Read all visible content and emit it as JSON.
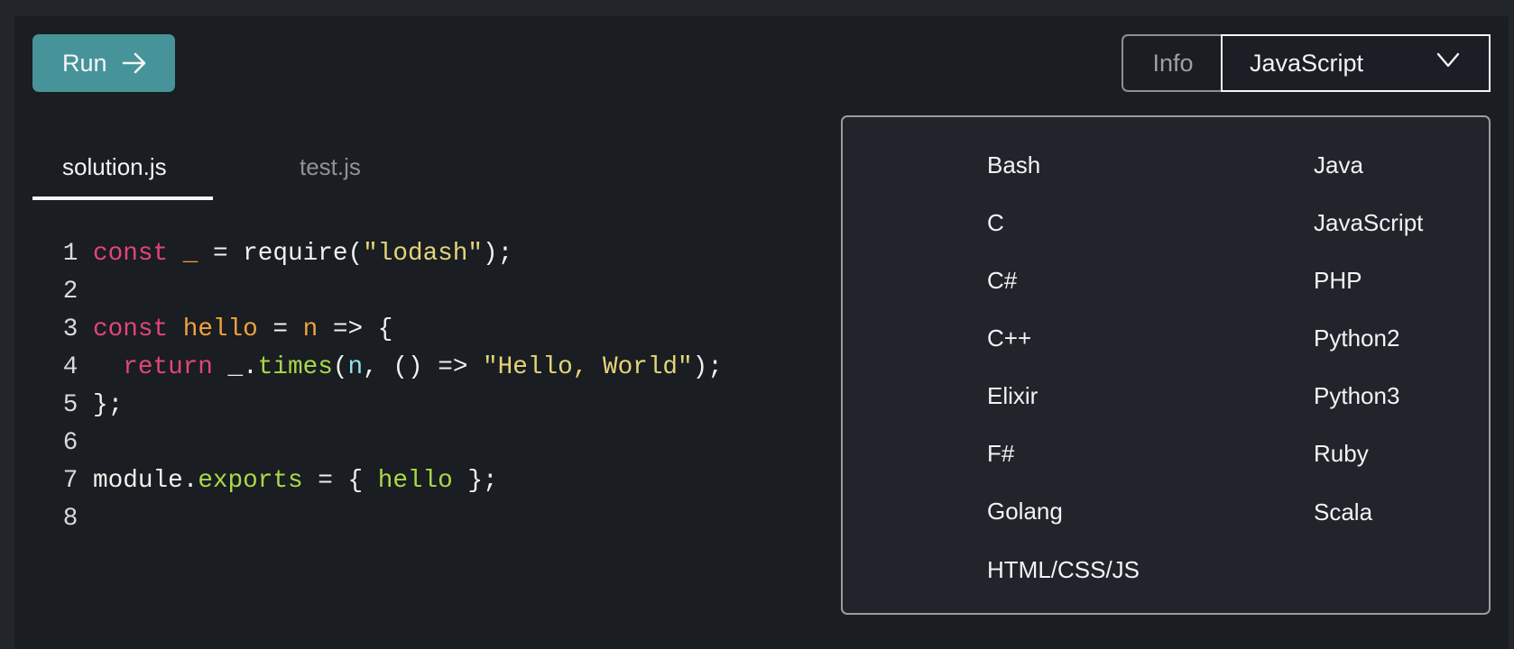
{
  "toolbar": {
    "run_label": "Run",
    "run_icon": "arrow-right-icon",
    "info_label": "Info",
    "language_selected": "JavaScript",
    "language_icon": "chevron-down-icon"
  },
  "colors": {
    "run_button": "#46949a",
    "background": "#1a1d21",
    "dropdown_background": "#21242b",
    "keyword": "#e34576",
    "variable": "#f0a13f",
    "string": "#e3d47a",
    "function": "#a8d94a",
    "parameter": "#8fe3ef"
  },
  "tabs": [
    {
      "label": "solution.js",
      "active": true
    },
    {
      "label": "test.js",
      "active": false
    }
  ],
  "code": {
    "lines": [
      {
        "n": "1",
        "tokens": [
          {
            "t": "const",
            "c": "kw"
          },
          {
            "t": " "
          },
          {
            "t": "_",
            "c": "or"
          },
          {
            "t": " = require("
          },
          {
            "t": "\"lodash\"",
            "c": "st"
          },
          {
            "t": ");"
          }
        ]
      },
      {
        "n": "2",
        "tokens": []
      },
      {
        "n": "3",
        "tokens": [
          {
            "t": "const",
            "c": "kw"
          },
          {
            "t": " "
          },
          {
            "t": "hello",
            "c": "or"
          },
          {
            "t": " = "
          },
          {
            "t": "n",
            "c": "or"
          },
          {
            "t": " => {"
          }
        ]
      },
      {
        "n": "4",
        "tokens": [
          {
            "t": "  "
          },
          {
            "t": "return",
            "c": "kw"
          },
          {
            "t": " _."
          },
          {
            "t": "times",
            "c": "fn"
          },
          {
            "t": "("
          },
          {
            "t": "n",
            "c": "cy"
          },
          {
            "t": ", () => "
          },
          {
            "t": "\"Hello, World\"",
            "c": "st"
          },
          {
            "t": ");"
          }
        ]
      },
      {
        "n": "5",
        "tokens": [
          {
            "t": "};"
          }
        ]
      },
      {
        "n": "6",
        "tokens": []
      },
      {
        "n": "7",
        "tokens": [
          {
            "t": "module."
          },
          {
            "t": "exports",
            "c": "fn"
          },
          {
            "t": " = { "
          },
          {
            "t": "hello",
            "c": "fn"
          },
          {
            "t": " };"
          }
        ]
      },
      {
        "n": "8",
        "tokens": []
      }
    ]
  },
  "dropdown": {
    "columns": [
      [
        "Bash",
        "C",
        "C#",
        "C++",
        "Elixir",
        "F#",
        "Golang",
        "HTML/CSS/JS"
      ],
      [
        "Java",
        "JavaScript",
        "PHP",
        "Python2",
        "Python3",
        "Ruby",
        "Scala"
      ]
    ]
  }
}
